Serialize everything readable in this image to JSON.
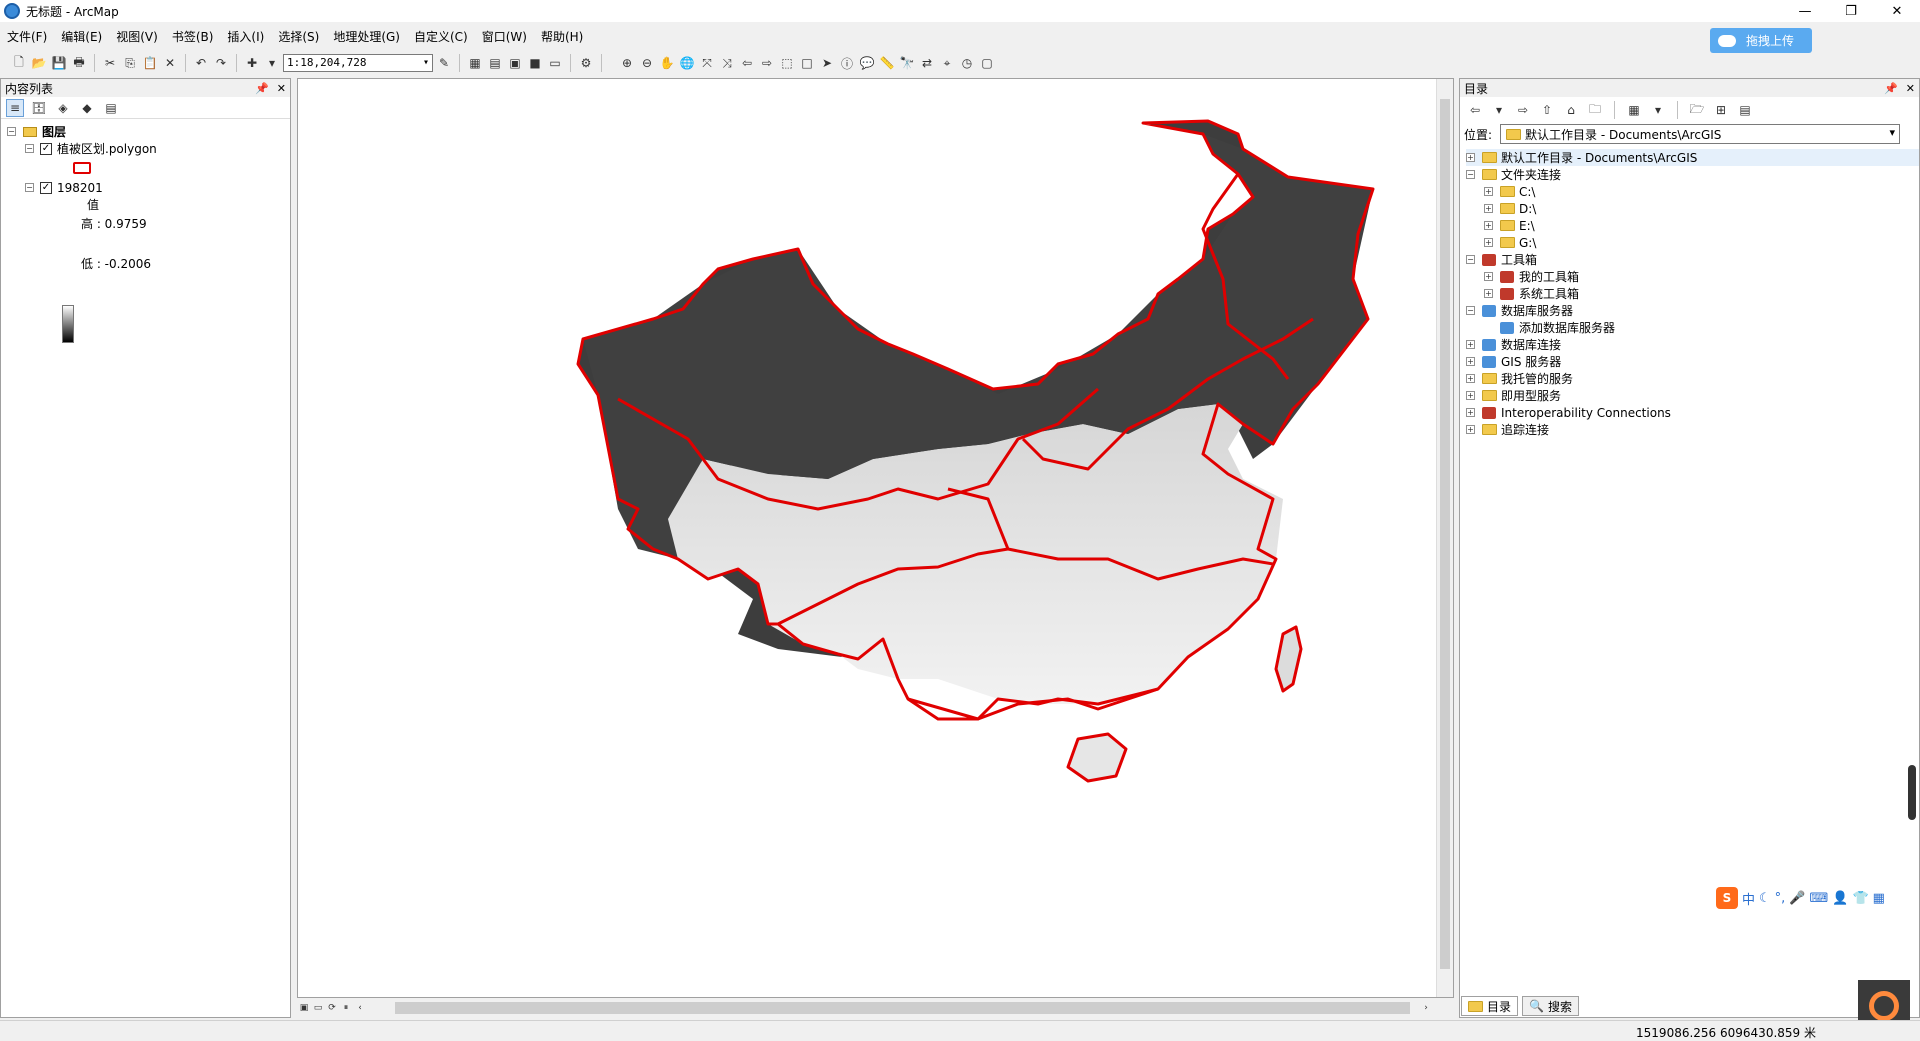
{
  "window": {
    "title": "无标题 - ArcMap"
  },
  "upload_button": {
    "label": "拖拽上传"
  },
  "menu": [
    "文件(F)",
    "编辑(E)",
    "视图(V)",
    "书签(B)",
    "插入(I)",
    "选择(S)",
    "地理处理(G)",
    "自定义(C)",
    "窗口(W)",
    "帮助(H)"
  ],
  "toolbar": {
    "scale": "1:18,204,728"
  },
  "toc": {
    "title": "内容列表",
    "root": "图层",
    "layer1": {
      "name": "植被区划.polygon"
    },
    "layer2": {
      "name": "198201",
      "value_label": "值",
      "high": "高 : 0.9759",
      "low": "低 : -0.2006"
    }
  },
  "catalog": {
    "title": "目录",
    "location_label": "位置:",
    "location_value": "默认工作目录 - Documents\\ArcGIS",
    "items": [
      {
        "label": "默认工作目录 - Documents\\ArcGIS",
        "level": 0,
        "exp": "+",
        "icon": "folder"
      },
      {
        "label": "文件夹连接",
        "level": 0,
        "exp": "−",
        "icon": "folder"
      },
      {
        "label": "C:\\",
        "level": 1,
        "exp": "+",
        "icon": "folder"
      },
      {
        "label": "D:\\",
        "level": 1,
        "exp": "+",
        "icon": "folder"
      },
      {
        "label": "E:\\",
        "level": 1,
        "exp": "+",
        "icon": "folder"
      },
      {
        "label": "G:\\",
        "level": 1,
        "exp": "+",
        "icon": "folder"
      },
      {
        "label": "工具箱",
        "level": 0,
        "exp": "−",
        "icon": "toolbox"
      },
      {
        "label": "我的工具箱",
        "level": 1,
        "exp": "+",
        "icon": "toolbox"
      },
      {
        "label": "系统工具箱",
        "level": 1,
        "exp": "+",
        "icon": "toolbox"
      },
      {
        "label": "数据库服务器",
        "level": 0,
        "exp": "−",
        "icon": "server"
      },
      {
        "label": "添加数据库服务器",
        "level": 1,
        "exp": "",
        "icon": "server"
      },
      {
        "label": "数据库连接",
        "level": 0,
        "exp": "+",
        "icon": "server"
      },
      {
        "label": "GIS 服务器",
        "level": 0,
        "exp": "+",
        "icon": "server"
      },
      {
        "label": "我托管的服务",
        "level": 0,
        "exp": "+",
        "icon": "folder"
      },
      {
        "label": "即用型服务",
        "level": 0,
        "exp": "+",
        "icon": "folder"
      },
      {
        "label": "Interoperability Connections",
        "level": 0,
        "exp": "+",
        "icon": "toolbox"
      },
      {
        "label": "追踪连接",
        "level": 0,
        "exp": "+",
        "icon": "folder"
      }
    ]
  },
  "tabs": {
    "catalog": "目录",
    "search": "搜索"
  },
  "status": {
    "coords": "1519086.256  6096430.859 米"
  },
  "colors": {
    "boundary": "#e00000",
    "upload": "#5aaaf0"
  }
}
